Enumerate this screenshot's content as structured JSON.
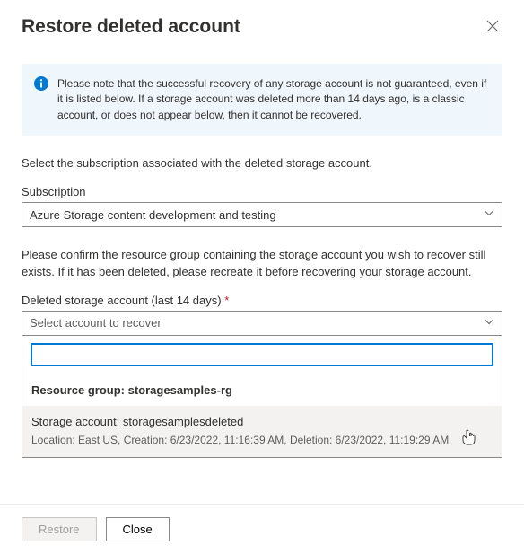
{
  "header": {
    "title": "Restore deleted account"
  },
  "info": {
    "text": "Please note that the successful recovery of any storage account is not guaranteed, even if it is listed below. If a storage account was deleted more than 14 days ago, is a classic account, or does not appear below, then it cannot be recovered."
  },
  "subscription": {
    "intro": "Select the subscription associated with the deleted storage account.",
    "label": "Subscription",
    "value": "Azure Storage content development and testing"
  },
  "deleted": {
    "intro": "Please confirm the resource group containing the storage account you wish to recover still exists. If it has been deleted, please recreate it before recovering your storage account.",
    "label": "Deleted storage account (last 14 days)",
    "placeholder": "Select account to recover",
    "group_header": "Resource group: storagesamples-rg",
    "option": {
      "title": "Storage account: storagesamplesdeleted",
      "subtitle": "Location: East US, Creation: 6/23/2022, 11:16:39 AM, Deletion: 6/23/2022, 11:19:29 AM"
    }
  },
  "footer": {
    "restore": "Restore",
    "close": "Close"
  }
}
